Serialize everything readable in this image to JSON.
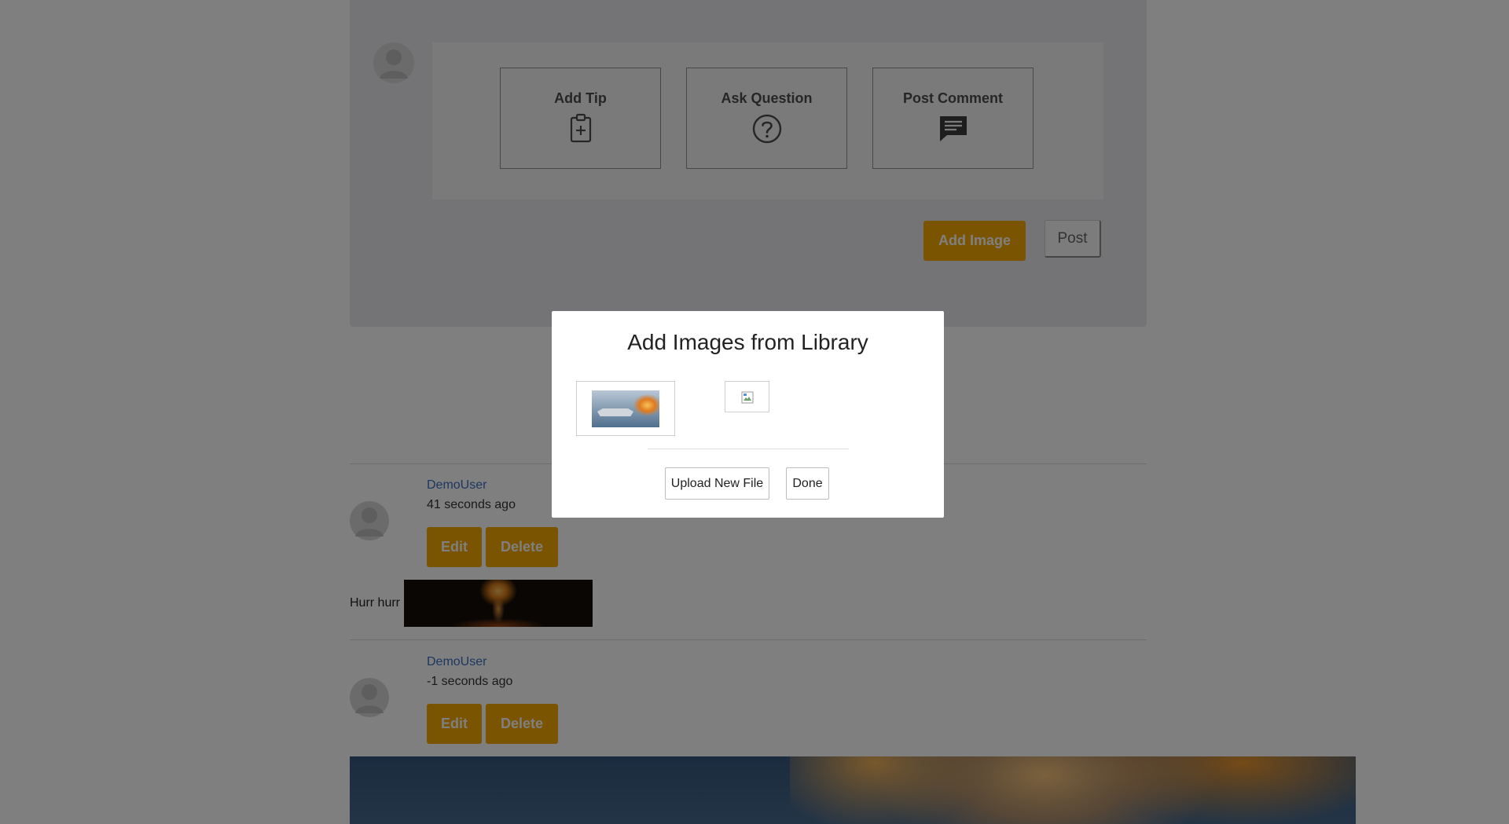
{
  "composer": {
    "options": [
      {
        "label": "Add Tip",
        "icon": "clipboard-plus-icon"
      },
      {
        "label": "Ask Question",
        "icon": "question-circle-icon"
      },
      {
        "label": "Post Comment",
        "icon": "comment-icon"
      }
    ],
    "add_image_label": "Add Image",
    "post_label": "Post"
  },
  "posts": [
    {
      "user": "DemoUser",
      "time": "41 seconds ago",
      "edit_label": "Edit",
      "delete_label": "Delete",
      "text": "Hurr hurr"
    },
    {
      "user": "DemoUser",
      "time": "-1 seconds ago",
      "edit_label": "Edit",
      "delete_label": "Delete"
    }
  ],
  "modal": {
    "title": "Add Images from Library",
    "upload_label": "Upload New File",
    "done_label": "Done"
  },
  "colors": {
    "accent": "#f6a800",
    "link": "#3a6ebf",
    "overlay": "rgba(0,0,0,0.5)"
  }
}
